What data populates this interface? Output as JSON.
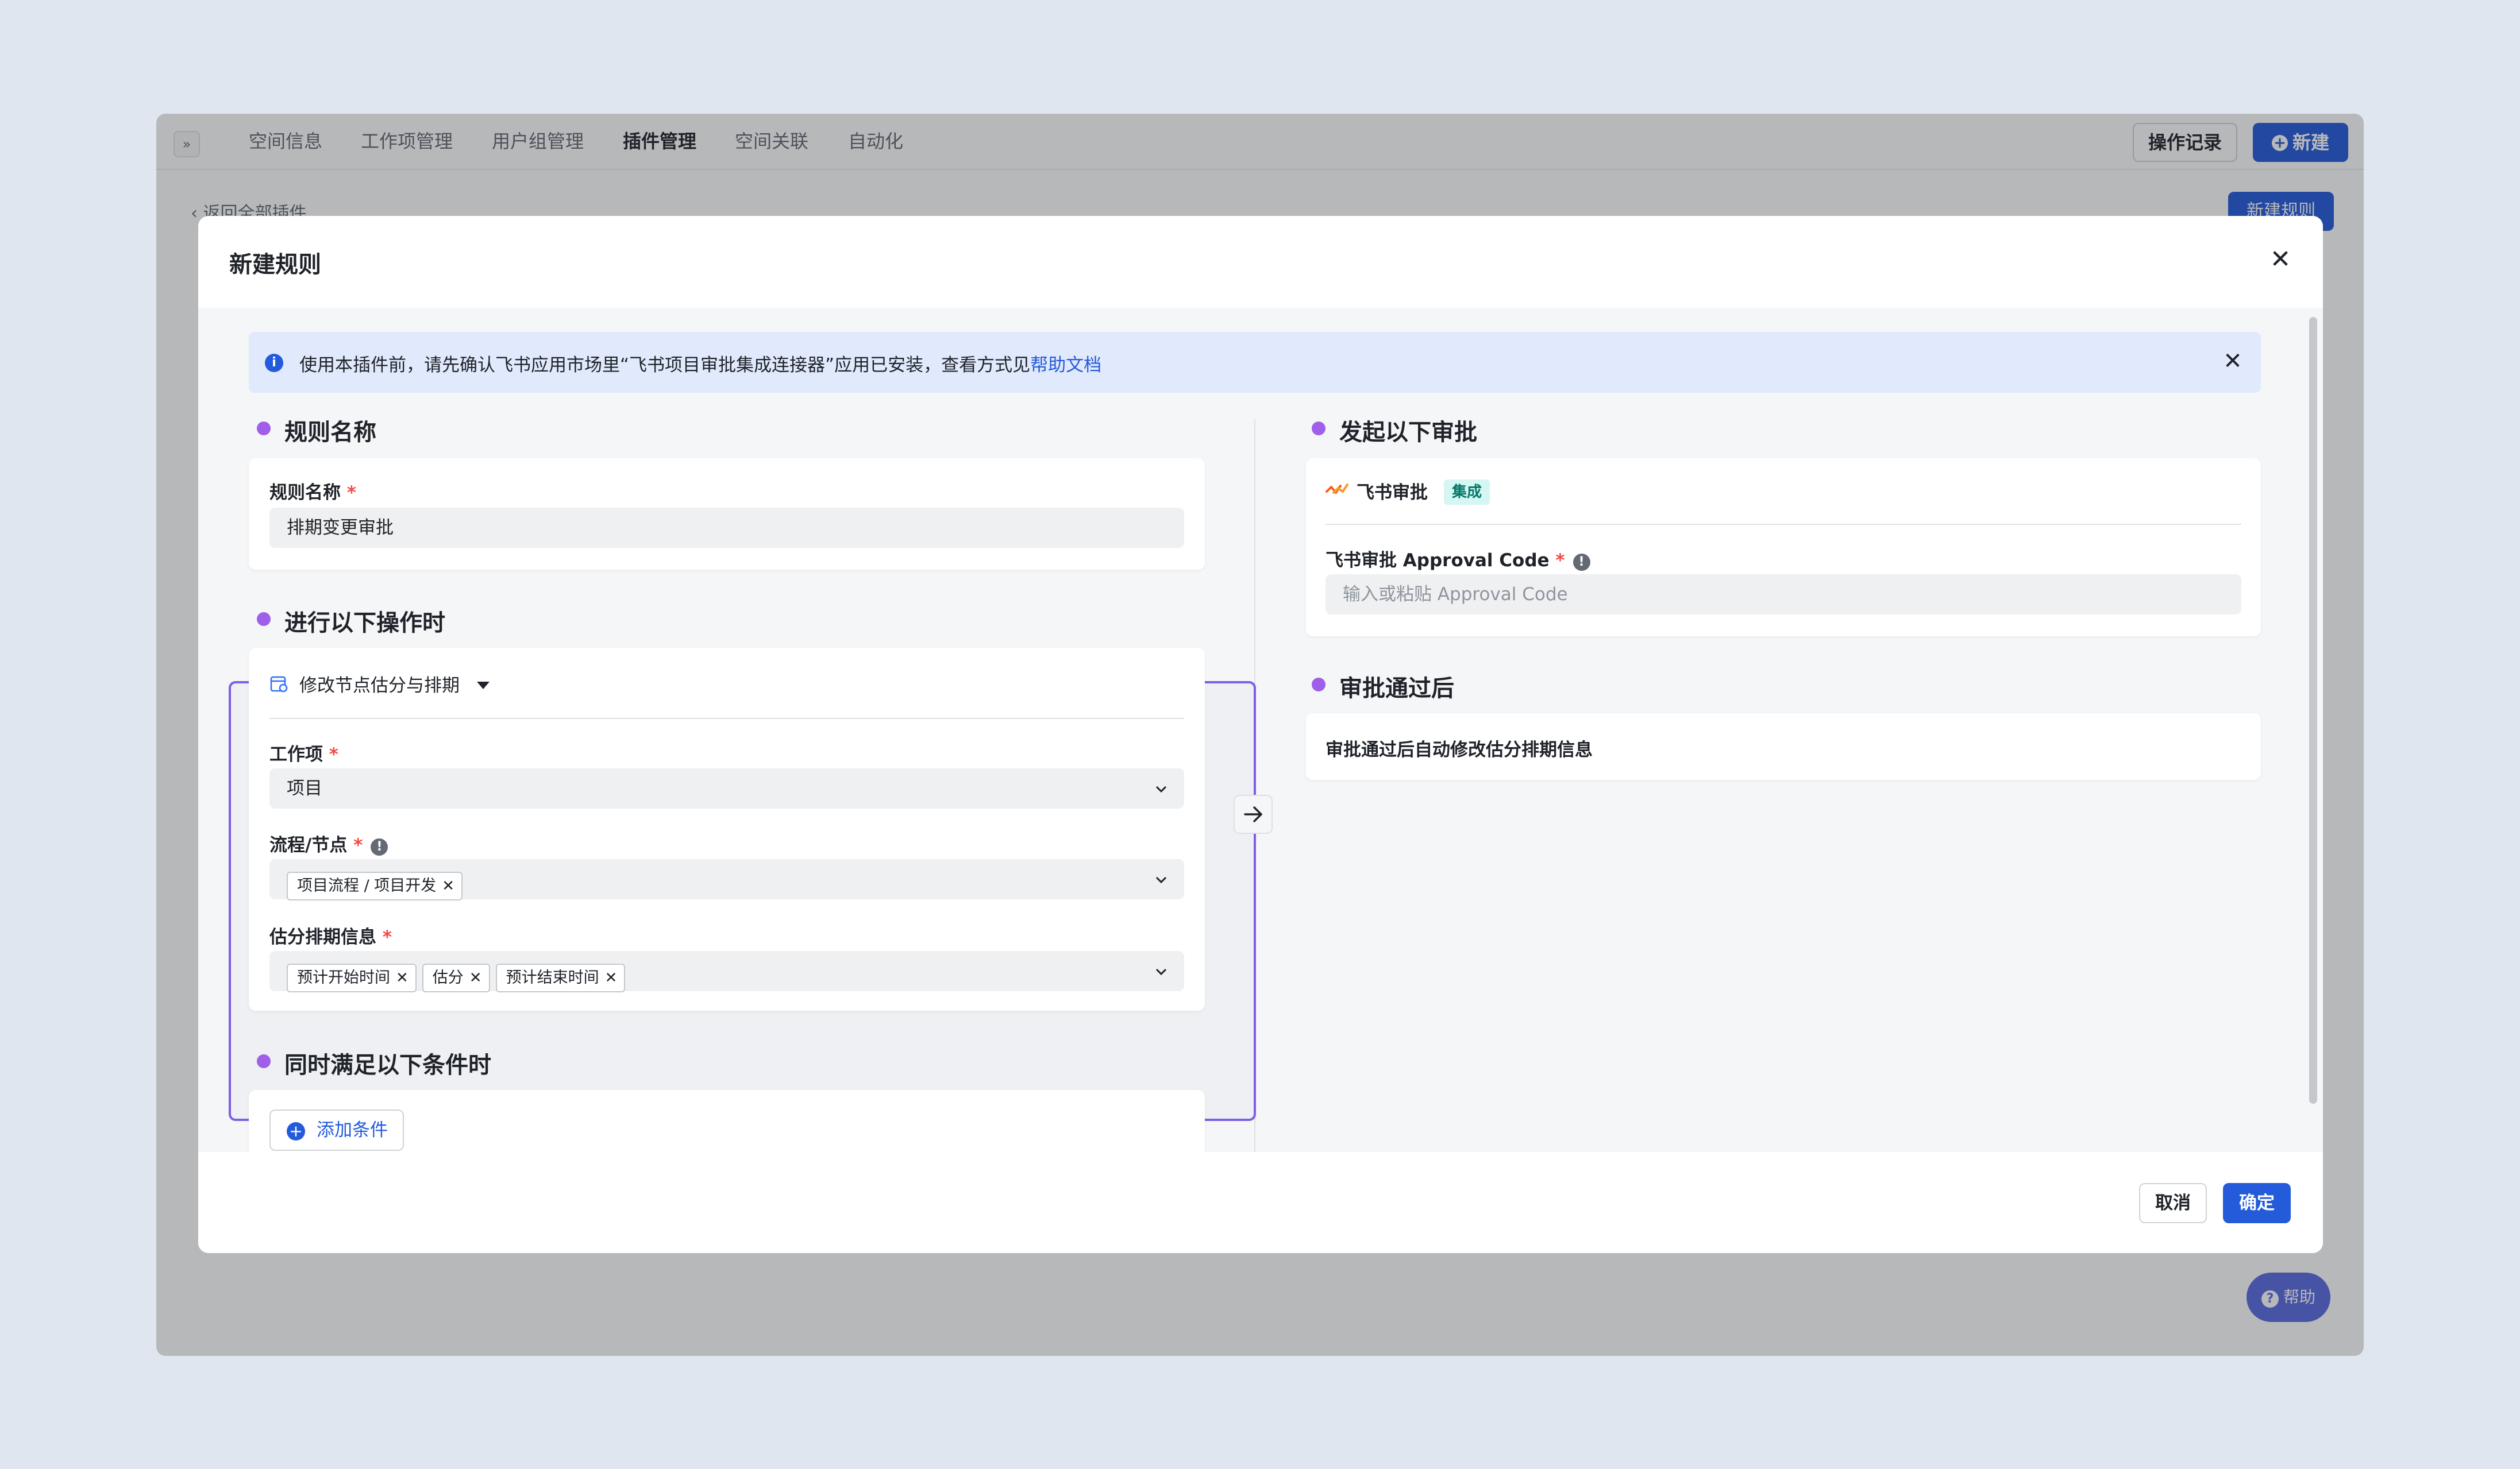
{
  "topbar": {
    "expand_glyph": "»",
    "tabs": [
      "空间信息",
      "工作项管理",
      "用户组管理",
      "插件管理",
      "空间关联",
      "自动化"
    ],
    "active_tab": "插件管理",
    "log_button": "操作记录",
    "new_button": "新建"
  },
  "page": {
    "back_link": "返回全部插件",
    "new_rule_button": "新建规则",
    "help_button": "帮助"
  },
  "modal": {
    "title": "新建规则",
    "alert": {
      "text": "使用本插件前，请先确认飞书应用市场里“飞书项目审批集成连接器”应用已安装，查看方式见",
      "link": "帮助文档"
    },
    "sections": {
      "rule_name": {
        "title": "规则名称",
        "field_label": "规则名称",
        "value": "排期变更审批"
      },
      "trigger": {
        "title": "进行以下操作时",
        "operation": "修改节点估分与排期",
        "work_item": {
          "label": "工作项",
          "value": "项目"
        },
        "flow_node": {
          "label": "流程/节点",
          "tags": [
            "项目流程 / 项目开发"
          ]
        },
        "estimate": {
          "label": "估分排期信息",
          "tags": [
            "预计开始时间",
            "估分",
            "预计结束时间"
          ]
        }
      },
      "conditions": {
        "title": "同时满足以下条件时",
        "add_button": "添加条件"
      },
      "approval": {
        "title": "发起以下审批",
        "app_name": "飞书审批",
        "badge": "集成",
        "code_label": "飞书审批 Approval Code",
        "code_placeholder": "输入或粘贴 Approval Code"
      },
      "after": {
        "title": "审批通过后",
        "text": "审批通过后自动修改估分排期信息"
      }
    },
    "required_mark": "*",
    "tip_glyph": "!",
    "footer": {
      "cancel": "取消",
      "confirm": "确定"
    }
  },
  "colors": {
    "accent": "#245bdb",
    "section_dot": "#9f5fe8",
    "highlight_border": "#7c5fe6",
    "required": "#f54a45",
    "badge_bg": "#d5f6f2",
    "badge_text": "#04786a"
  },
  "icons": {
    "close": "close-icon",
    "info": "info-icon",
    "chevron": "chevron-down-icon",
    "arrow": "arrow-right-icon",
    "tag_remove": "tag-remove-icon",
    "operation": "calendar-edit-icon",
    "lark": "feishu-approval-logo-icon"
  }
}
